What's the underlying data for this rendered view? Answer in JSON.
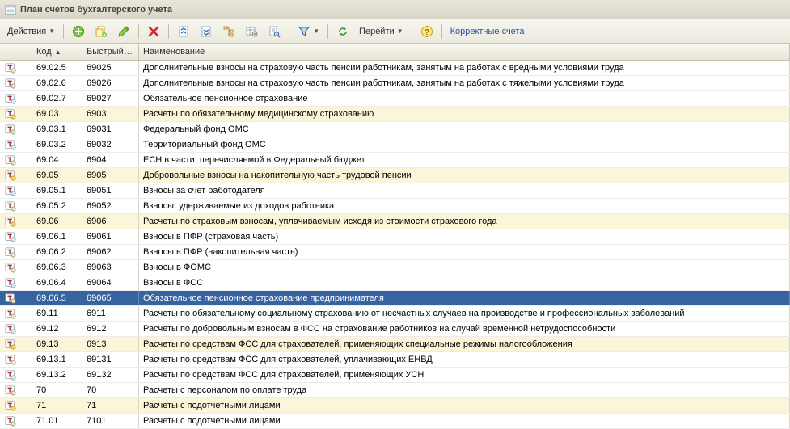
{
  "window": {
    "title": "План счетов бухгалтерского учета"
  },
  "toolbar": {
    "actions_label": "Действия",
    "goto_label": "Перейти",
    "correct_label": "Корректные счета"
  },
  "columns": {
    "icon": "",
    "code": "Код",
    "fast": "Быстрый…",
    "name": "Наименование"
  },
  "rows": [
    {
      "code": "69.02.5",
      "fast": "69025",
      "name": "Дополнительные взносы на страховую часть пенсии работникам, занятым на работах с вредными условиями труда",
      "hl": false
    },
    {
      "code": "69.02.6",
      "fast": "69026",
      "name": "Дополнительные взносы на страховую часть пенсии работникам, занятым на работах с тяжелыми условиями труда",
      "hl": false
    },
    {
      "code": "69.02.7",
      "fast": "69027",
      "name": "Обязательное пенсионное страхование",
      "hl": false
    },
    {
      "code": "69.03",
      "fast": "6903",
      "name": "Расчеты по обязательному медицинскому страхованию",
      "hl": true
    },
    {
      "code": "69.03.1",
      "fast": "69031",
      "name": "Федеральный фонд ОМС",
      "hl": false
    },
    {
      "code": "69.03.2",
      "fast": "69032",
      "name": "Территориальный фонд ОМС",
      "hl": false
    },
    {
      "code": "69.04",
      "fast": "6904",
      "name": "ЕСН в части, перечисляемой в Федеральный бюджет",
      "hl": false
    },
    {
      "code": "69.05",
      "fast": "6905",
      "name": "Добровольные взносы на накопительную часть трудовой пенсии",
      "hl": true
    },
    {
      "code": "69.05.1",
      "fast": "69051",
      "name": "Взносы за счет работодателя",
      "hl": false
    },
    {
      "code": "69.05.2",
      "fast": "69052",
      "name": "Взносы, удерживаемые из доходов работника",
      "hl": false
    },
    {
      "code": "69.06",
      "fast": "6906",
      "name": "Расчеты по страховым взносам, уплачиваемым исходя из стоимости страхового года",
      "hl": true
    },
    {
      "code": "69.06.1",
      "fast": "69061",
      "name": "Взносы в ПФР (страховая часть)",
      "hl": false
    },
    {
      "code": "69.06.2",
      "fast": "69062",
      "name": "Взносы в ПФР (накопительная часть)",
      "hl": false
    },
    {
      "code": "69.06.3",
      "fast": "69063",
      "name": "Взносы в ФОМС",
      "hl": false
    },
    {
      "code": "69.06.4",
      "fast": "69064",
      "name": "Взносы в ФСС",
      "hl": false
    },
    {
      "code": "69.06.5",
      "fast": "69065",
      "name": "Обязательное пенсионное страхование предпринимателя",
      "hl": false,
      "selected": true
    },
    {
      "code": "69.11",
      "fast": "6911",
      "name": "Расчеты по обязательному социальному страхованию от несчастных случаев на производстве и профессиональных заболеваний",
      "hl": false
    },
    {
      "code": "69.12",
      "fast": "6912",
      "name": "Расчеты по добровольным взносам в ФСС на страхование работников на случай временной нетрудоспособности",
      "hl": false
    },
    {
      "code": "69.13",
      "fast": "6913",
      "name": "Расчеты по средствам ФСС для страхователей, применяющих специальные режимы налогообложения",
      "hl": true
    },
    {
      "code": "69.13.1",
      "fast": "69131",
      "name": "Расчеты по средствам ФСС для страхователей, уплачивающих ЕНВД",
      "hl": false
    },
    {
      "code": "69.13.2",
      "fast": "69132",
      "name": "Расчеты по средствам ФСС для страхователей, применяющих УСН",
      "hl": false
    },
    {
      "code": "70",
      "fast": "70",
      "name": "Расчеты с персоналом по оплате труда",
      "hl": false
    },
    {
      "code": "71",
      "fast": "71",
      "name": "Расчеты с подотчетными лицами",
      "hl": true
    },
    {
      "code": "71.01",
      "fast": "7101",
      "name": "Расчеты с подотчетными лицами",
      "hl": false
    }
  ]
}
